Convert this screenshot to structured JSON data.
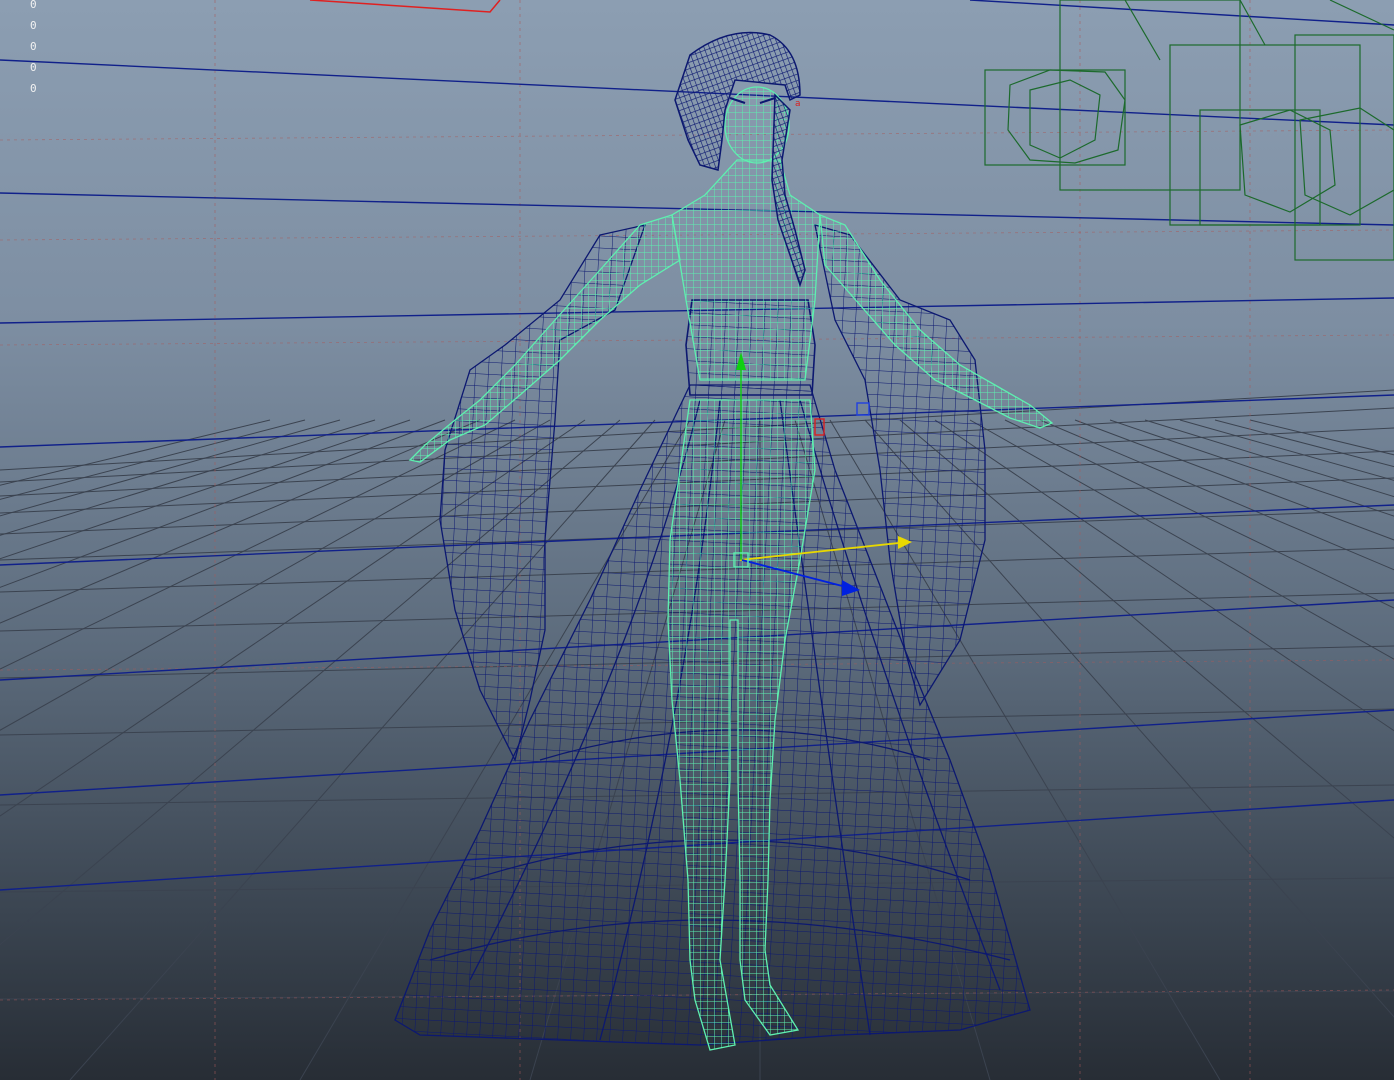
{
  "viewport": {
    "name": "perspective-viewport",
    "background_top": "#8c9eb2",
    "background_bottom": "#272d35"
  },
  "hud": {
    "values": [
      "0",
      "0",
      "0",
      "0",
      "0"
    ]
  },
  "colors": {
    "grid_line": "#3b4350",
    "grid_axis_dashed": "#a85a5a",
    "horizon_blue": "#10208a",
    "body_wire": "#5ef0b0",
    "cloth_wire": "#0c1870",
    "control_wire": "#1c6a2c",
    "gizmo_yellow": "#e8d800",
    "gizmo_blue": "#0020e0",
    "gizmo_green": "#10d010",
    "locator_red": "#d82020",
    "camera_red": "#e02020"
  },
  "objects": {
    "character": "character-mesh-wireframe",
    "dress": "dress-mesh-wireframe",
    "hair": "hair-mesh-wireframe",
    "controls": "rig-control-curves",
    "manipulator": "move-manipulator"
  }
}
